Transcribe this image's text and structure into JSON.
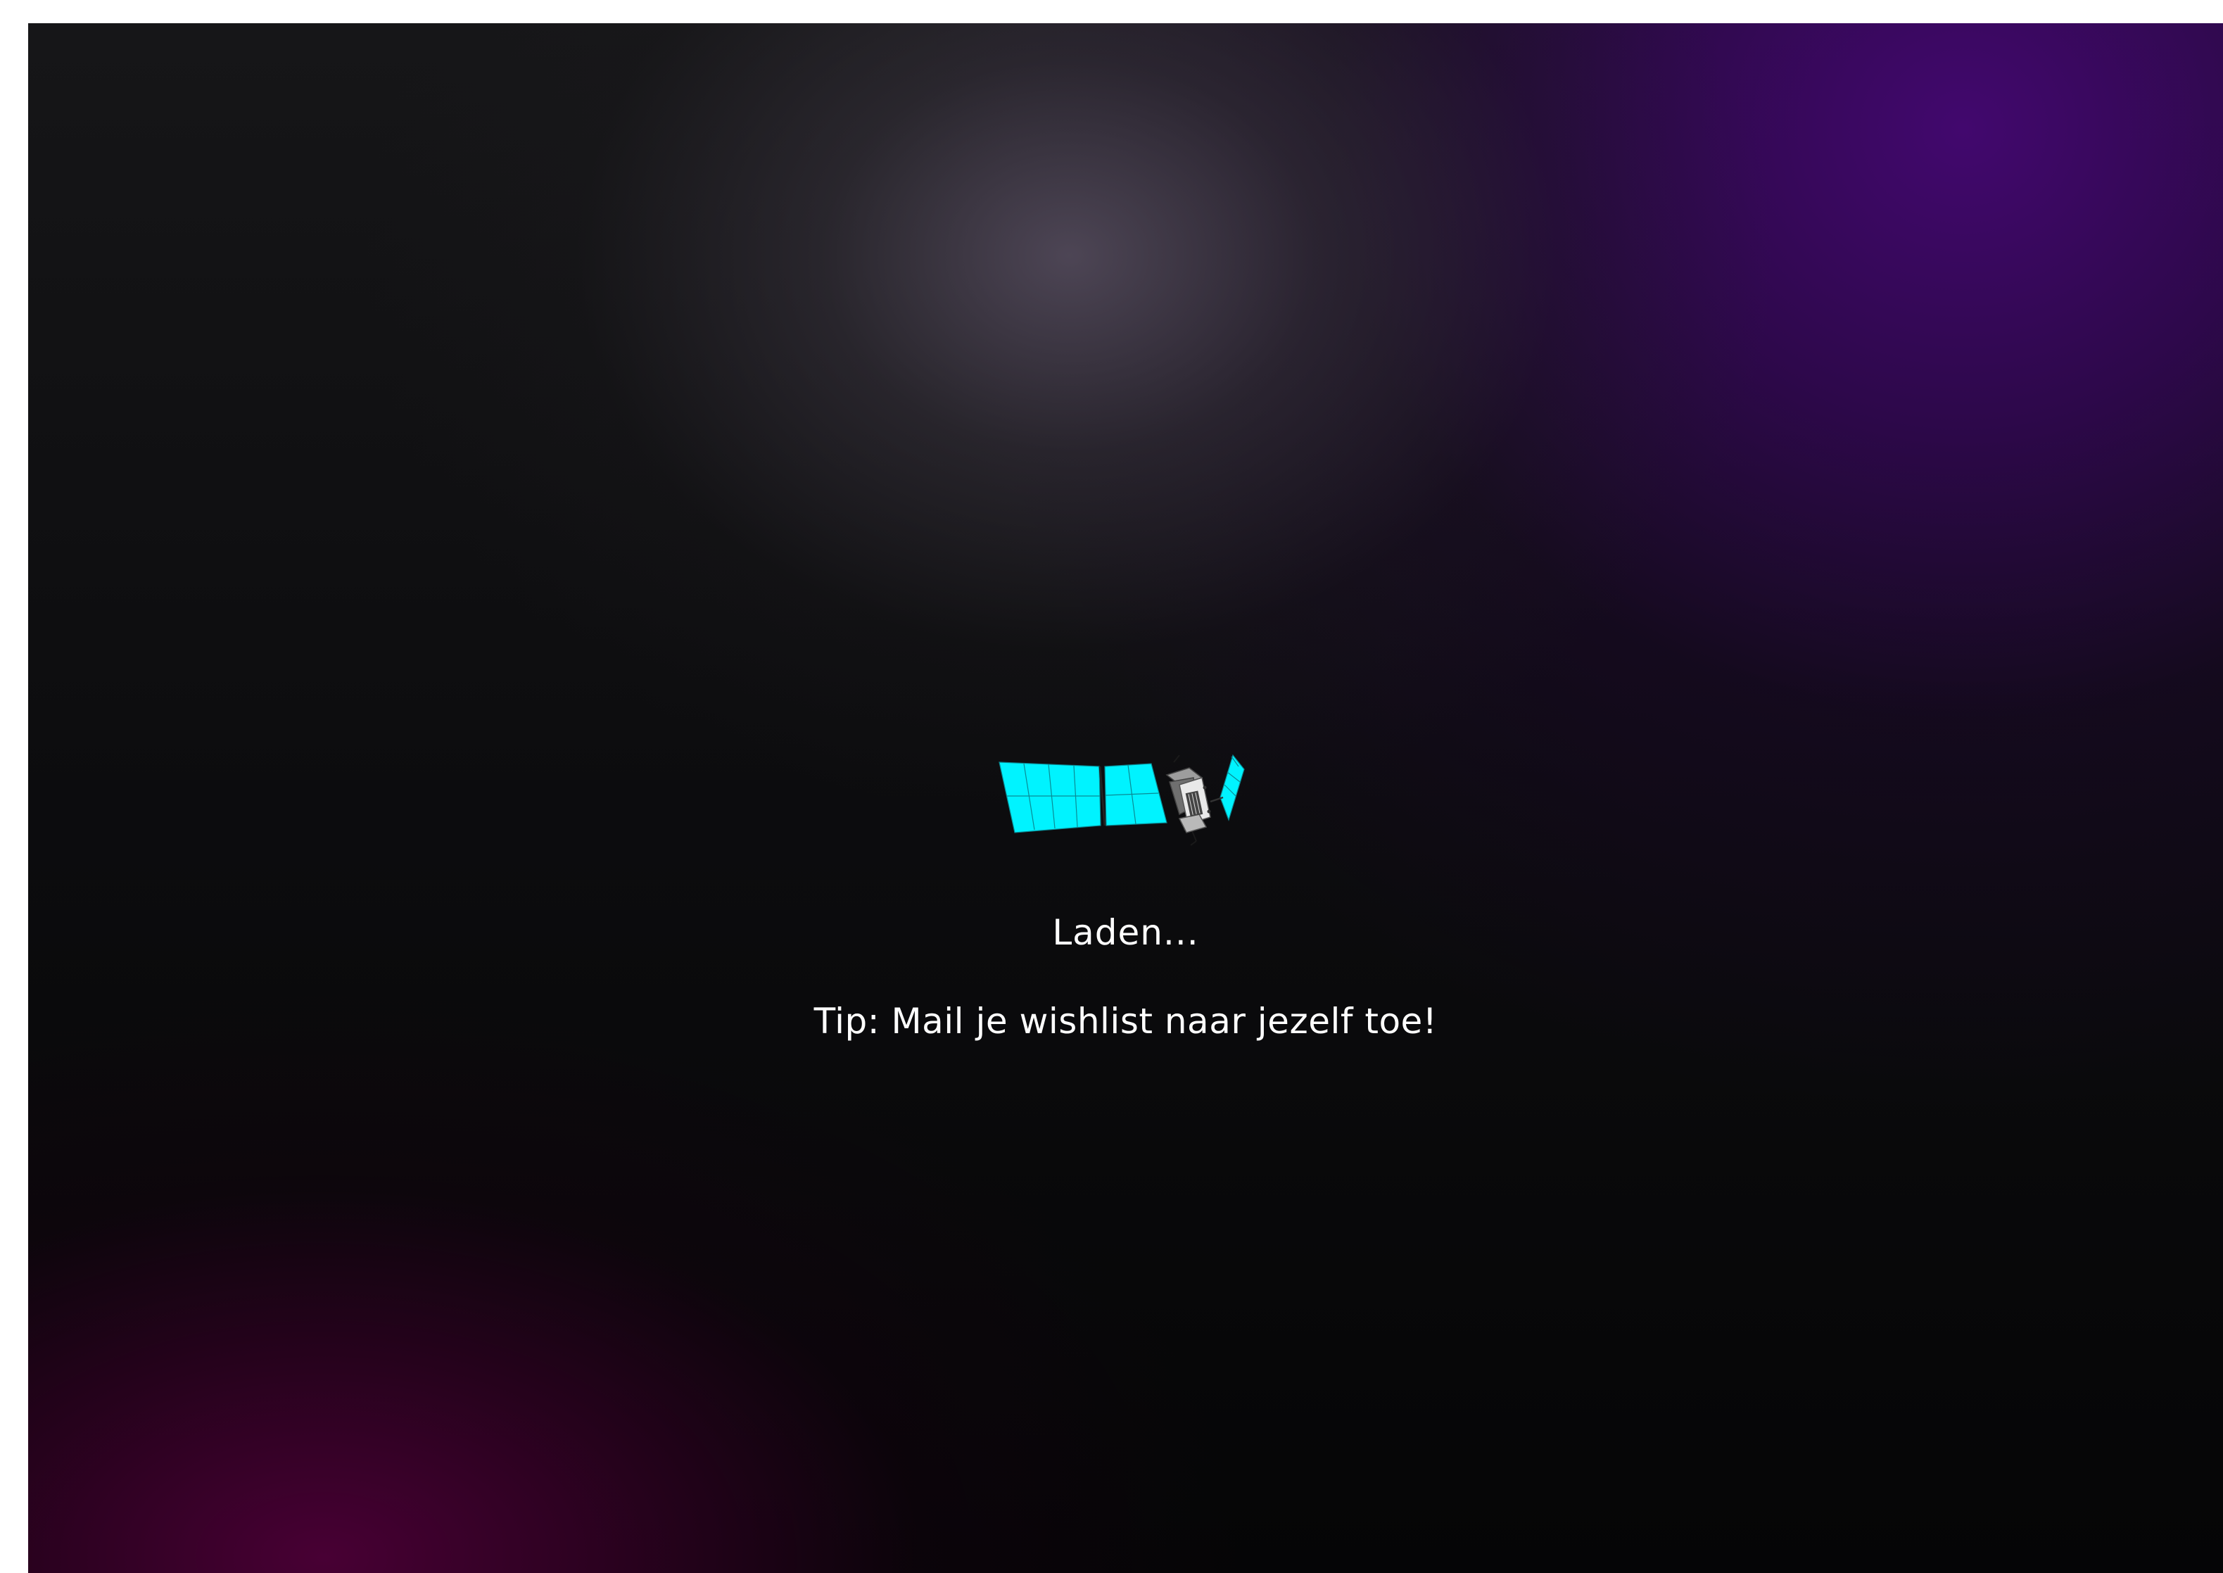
{
  "loader": {
    "icon": "satellite-icon",
    "status_label": "Laden...",
    "tip_text": "Tip: Mail je wishlist naar jezelf toe!"
  },
  "colors": {
    "panel_accent": "#00ffff",
    "text": "#ffffff",
    "glow_purple": "#42086e",
    "glow_magenta": "#480034",
    "glow_grey": "#504858"
  }
}
